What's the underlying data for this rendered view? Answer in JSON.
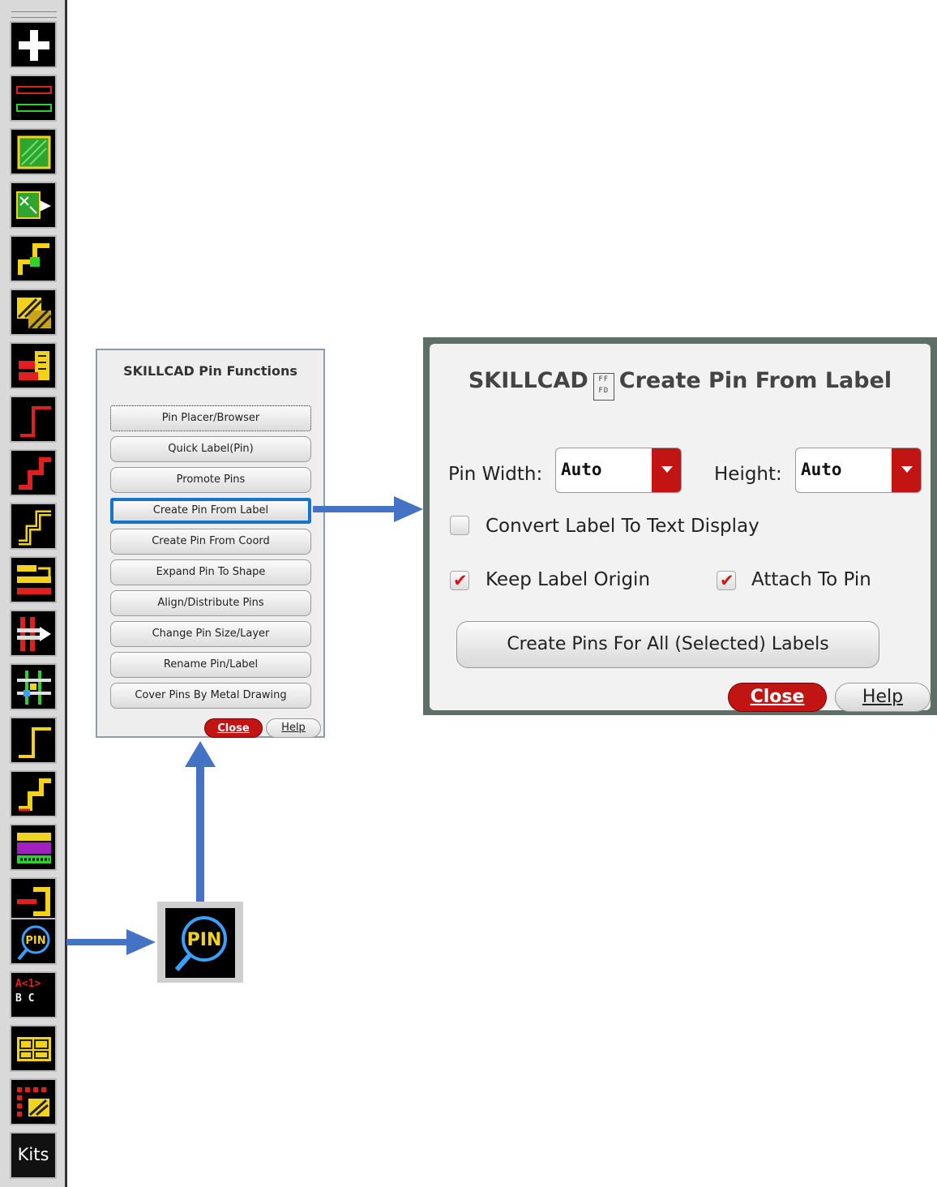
{
  "toolbar": {
    "icons": [
      "add-icon",
      "metal-lines-icon",
      "via-fill-icon",
      "move-array-icon",
      "wire-step-icon",
      "hatch-shape-icon",
      "stack-icon",
      "wire-corner-icon",
      "wire-jog-icon",
      "wire-double-jog-icon",
      "bus-route-icon",
      "move-wires-icon",
      "crossing-icon",
      "corner-route-icon",
      "jog-route-icon",
      "guard-ring-icon",
      "pin-extend-icon",
      "pin-functions-icon",
      "bus-label-icon",
      "tile-icon",
      "array-pattern-icon",
      "kits-button"
    ],
    "bus_label_line1": "A<1>",
    "bus_label_line2": "B C",
    "kits_label": "Kits"
  },
  "pin_menu": {
    "title": "SKILLCAD Pin Functions",
    "items": [
      "Pin Placer/Browser",
      "Quick Label(Pin)",
      "Promote Pins",
      "Create Pin From Label",
      "Create Pin From Coord",
      "Expand Pin To Shape",
      "Align/Distribute Pins",
      "Change Pin Size/Layer",
      "Rename Pin/Label",
      "Cover Pins By Metal Drawing"
    ],
    "selected_item": "Create Pin From Label",
    "close_label": "Close",
    "help_label": "Help"
  },
  "dialog": {
    "title_left": "SKILLCAD",
    "logo_text": "FF FD",
    "title_right": "Create Pin From Label",
    "pin_width_label": "Pin Width:",
    "pin_width_value": "Auto",
    "height_label": "Height:",
    "height_value": "Auto",
    "convert_label": "Convert Label To Text Display",
    "convert_checked": false,
    "keep_origin_label": "Keep Label Origin",
    "keep_origin_checked": true,
    "attach_label": "Attach To Pin",
    "attach_checked": true,
    "create_button": "Create Pins For All (Selected) Labels",
    "close_label": "Close",
    "help_label": "Help"
  },
  "zoom_icon": {
    "text": "PIN"
  },
  "colors": {
    "accent_red": "#c31414",
    "selection_blue": "#1673c7",
    "arrow_blue": "#4472c4",
    "icon_yellow": "#f2d21b",
    "icon_green": "#2fd12f",
    "icon_red": "#e02020"
  }
}
